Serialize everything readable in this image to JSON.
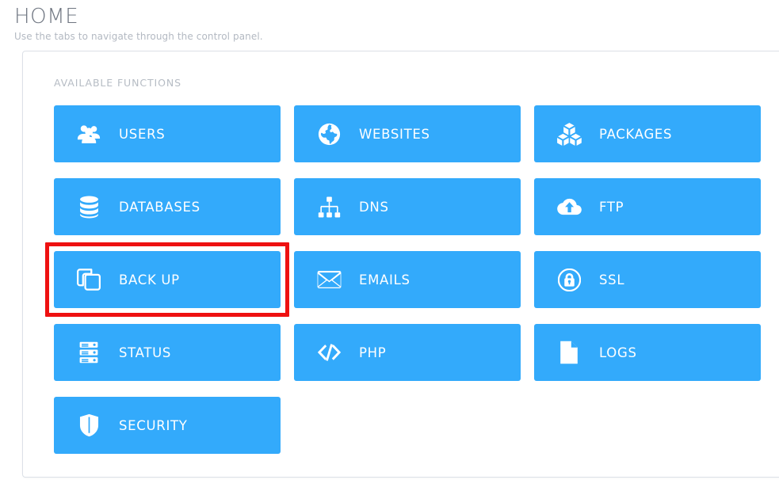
{
  "header": {
    "title": "HOME",
    "subtitle": "Use the tabs to navigate through the control panel."
  },
  "panel": {
    "label": "AVAILABLE FUNCTIONS"
  },
  "colors": {
    "tile_blue": "#33aafb",
    "tile_text": "#ffffff",
    "highlight_red": "#ee1111",
    "title_gray": "#6e7580",
    "subtitle_gray": "#b3b9c2",
    "card_border": "#dce0e7"
  },
  "functions": [
    {
      "label": "USERS",
      "icon": "users-icon",
      "highlighted": false
    },
    {
      "label": "WEBSITES",
      "icon": "globe-icon",
      "highlighted": false
    },
    {
      "label": "PACKAGES",
      "icon": "cubes-icon",
      "highlighted": false
    },
    {
      "label": "DATABASES",
      "icon": "database-icon",
      "highlighted": false
    },
    {
      "label": "DNS",
      "icon": "sitemap-icon",
      "highlighted": false
    },
    {
      "label": "FTP",
      "icon": "cloud-upload-icon",
      "highlighted": false
    },
    {
      "label": "BACK UP",
      "icon": "copy-icon",
      "highlighted": true
    },
    {
      "label": "EMAILS",
      "icon": "envelope-icon",
      "highlighted": false
    },
    {
      "label": "SSL",
      "icon": "lock-circle-icon",
      "highlighted": false
    },
    {
      "label": "STATUS",
      "icon": "server-icon",
      "highlighted": false
    },
    {
      "label": "PHP",
      "icon": "code-icon",
      "highlighted": false
    },
    {
      "label": "LOGS",
      "icon": "file-icon",
      "highlighted": false
    },
    {
      "label": "SECURITY",
      "icon": "shield-icon",
      "highlighted": false
    }
  ]
}
